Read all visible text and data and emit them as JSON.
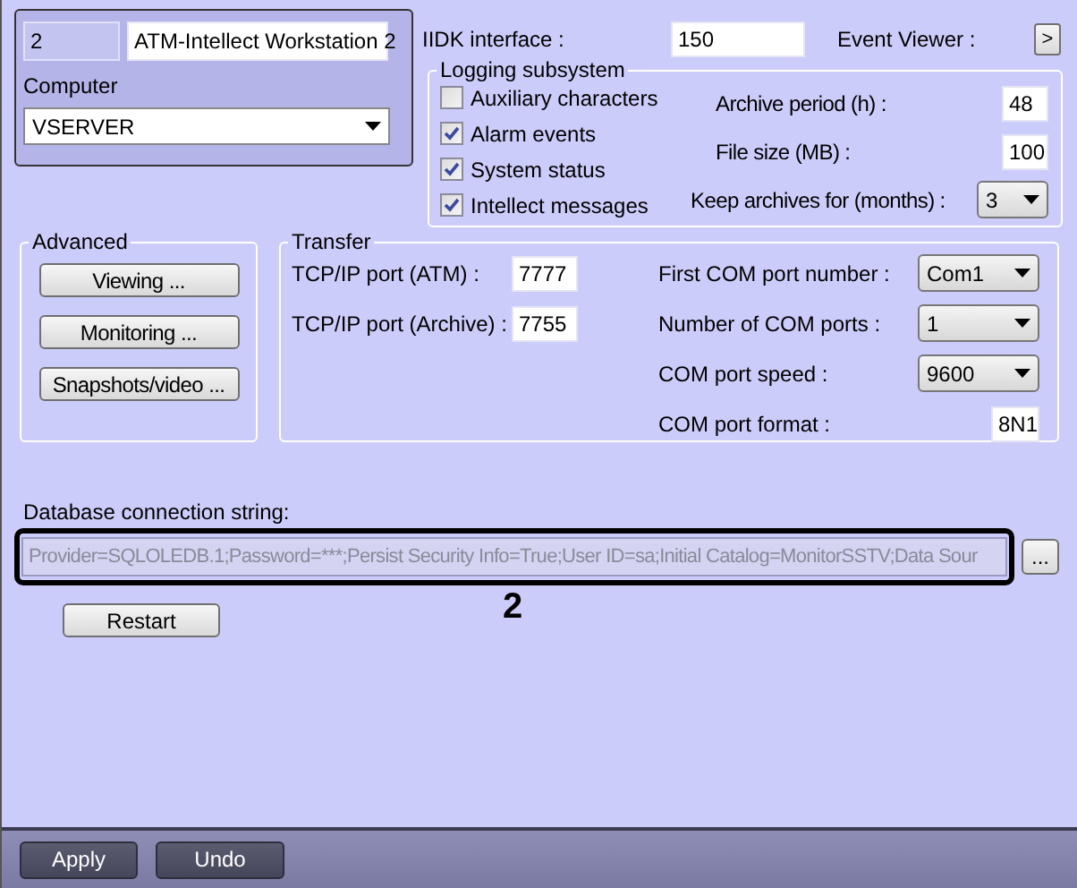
{
  "workstation": {
    "id": "2",
    "name": "ATM-Intellect Workstation 2",
    "computer_label": "Computer",
    "computer": "VSERVER"
  },
  "iidk": {
    "label": "IIDK interface :",
    "value": "150"
  },
  "event_viewer": {
    "label": "Event Viewer :",
    "button": ">"
  },
  "logging": {
    "title": "Logging subsystem",
    "options": [
      {
        "label": "Auxiliary characters",
        "checked": false
      },
      {
        "label": "Alarm events",
        "checked": true
      },
      {
        "label": "System status",
        "checked": true
      },
      {
        "label": "Intellect messages",
        "checked": true
      }
    ],
    "settings": [
      {
        "label": "Archive period (h) :",
        "value": "48",
        "kind": "field"
      },
      {
        "label": "File size (MB) :",
        "value": "100",
        "kind": "field"
      },
      {
        "label": "Keep archives for (months) :",
        "value": "3",
        "kind": "dropdown"
      }
    ]
  },
  "advanced": {
    "title": "Advanced",
    "buttons": [
      "Viewing ...",
      "Monitoring ...",
      "Snapshots/video ..."
    ]
  },
  "transfer": {
    "title": "Transfer",
    "ports": [
      {
        "label": "TCP/IP port (ATM) :",
        "value": "7777"
      },
      {
        "label": "TCP/IP port (Archive) :",
        "value": "7755"
      }
    ],
    "com": [
      {
        "label": "First COM port number :",
        "value": "Com1",
        "kind": "dropdown"
      },
      {
        "label": "Number of COM ports :",
        "value": "1",
        "kind": "dropdown"
      },
      {
        "label": "COM port speed :",
        "value": "9600",
        "kind": "dropdown"
      },
      {
        "label": "COM port format :",
        "value": "8N1",
        "kind": "field"
      }
    ]
  },
  "database": {
    "label": "Database connection string:",
    "value": "Provider=SQLOLEDB.1;Password=***;Persist Security Info=True;User ID=sa;Initial Catalog=MonitorSSTV;Data Sour",
    "browse": "...",
    "callout": "2"
  },
  "restart": "Restart",
  "footer": [
    "Apply",
    "Undo"
  ]
}
